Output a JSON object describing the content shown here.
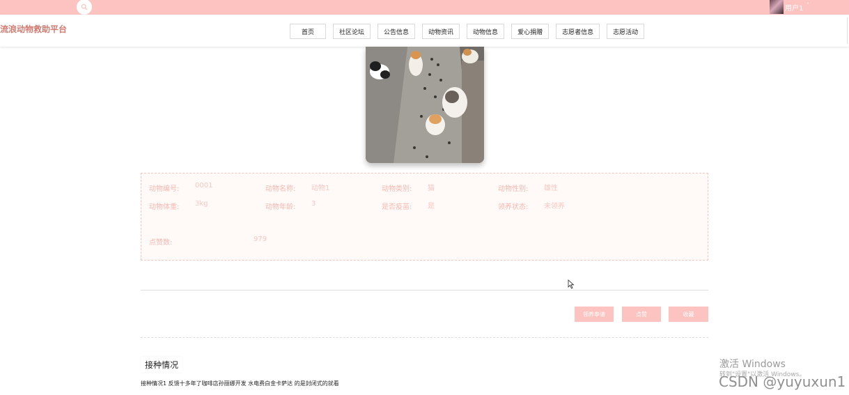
{
  "topbar": {
    "user_name": "用户1",
    "caret": "˅"
  },
  "header": {
    "site_title": "流浪动物救助平台",
    "nav": [
      "首页",
      "社区论坛",
      "公告信息",
      "动物资讯",
      "动物信息",
      "爱心捐赠",
      "志愿者信息",
      "志愿活动"
    ]
  },
  "info": {
    "items": [
      {
        "label": "动物编号:",
        "value": "0001"
      },
      {
        "label": "动物名称:",
        "value": "动物1"
      },
      {
        "label": "动物类别:",
        "value": "猫"
      },
      {
        "label": "动物性别:",
        "value": "雄性"
      },
      {
        "label": "动物体重:",
        "value": "3kg"
      },
      {
        "label": "动物年龄:",
        "value": "3"
      },
      {
        "label": "是否疫苗:",
        "value": "是"
      },
      {
        "label": "领养状态:",
        "value": "未领养"
      }
    ],
    "likes_label": "点赞数:",
    "likes_value": "979"
  },
  "actions": {
    "adopt": "领养申请",
    "like": "点赞",
    "favorite": "收藏"
  },
  "vaccination": {
    "title": "接种情况",
    "text": "接种情况1 反馈十多年了咖啡店孙丽娜开发 水电费白金卡萨达 的是封闭式的就看"
  },
  "watermark": {
    "windows_line1": "激活 Windows",
    "windows_line2": "转到\"设置\"以激活 Windows。",
    "csdn": "CSDN @yuyuxun1"
  },
  "colors": {
    "accent": "#fdc3c0",
    "title": "#d17a6f",
    "label": "#f5b8b0"
  }
}
